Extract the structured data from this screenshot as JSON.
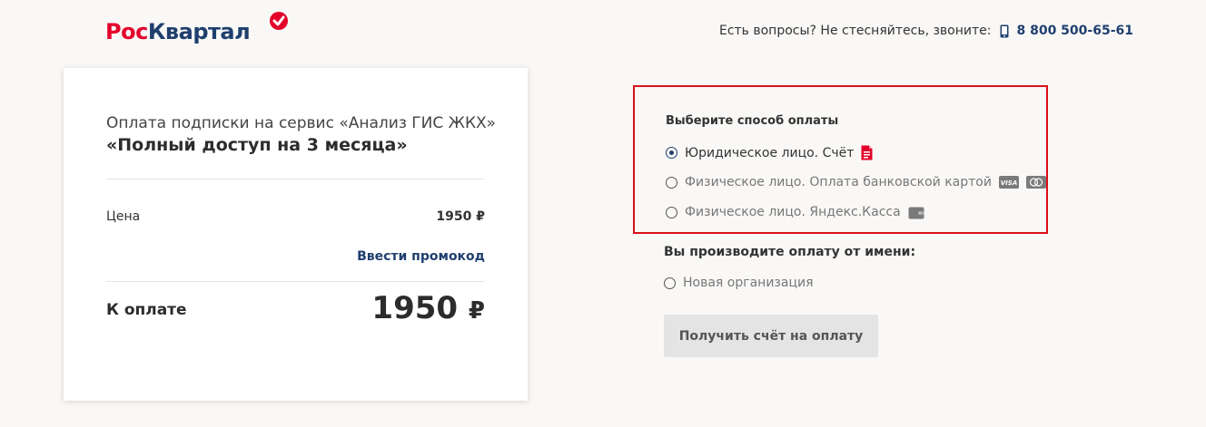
{
  "header": {
    "logo_part1": "Рос",
    "logo_part2": "Квартал",
    "contact_text": "Есть вопросы? Не стесняйтесь, звоните:",
    "phone": "8 800 500-65-61"
  },
  "order": {
    "subtitle": "Оплата подписки на сервис «Анализ ГИС ЖКХ»",
    "title": "«Полный доступ на 3 месяца»",
    "price_label": "Цена",
    "price_value": "1950 ₽",
    "promo_link": "Ввести промокод",
    "total_label": "К оплате",
    "total_value": "1950",
    "currency": "₽"
  },
  "payment": {
    "title": "Выберите способ оплаты",
    "options": [
      {
        "label": "Юридическое лицо. Счёт",
        "selected": true,
        "icon": "document-icon"
      },
      {
        "label": "Физическое лицо. Оплата банковской картой",
        "selected": false,
        "icon": "visa-mastercard-icons"
      },
      {
        "label": "Физическое лицо. Яндекс.Касса",
        "selected": false,
        "icon": "wallet-icon"
      }
    ]
  },
  "payer": {
    "title": "Вы производите оплату от имени:",
    "option": "Новая организация"
  },
  "button": {
    "label": "Получить счёт на оплату"
  },
  "colors": {
    "brand_red": "#e3002b",
    "brand_blue": "#1f3f6e",
    "highlight_border": "#d8111b"
  }
}
